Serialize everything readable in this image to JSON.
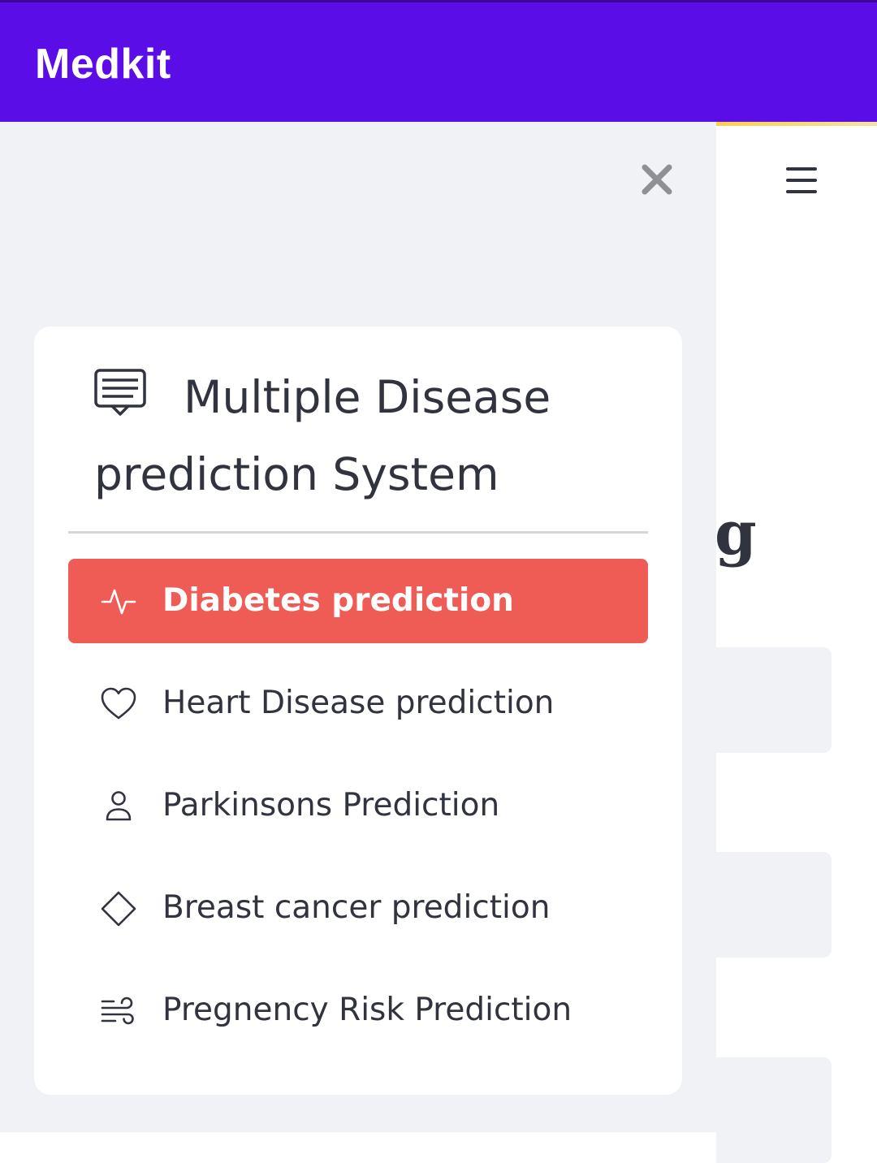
{
  "app": {
    "title": "Medkit",
    "accent_color": "#5b0de8"
  },
  "main_content": {
    "heading_fragment": "g"
  },
  "sidebar": {
    "close_icon": "close-icon",
    "menu": {
      "title": "Multiple Disease prediction System",
      "title_icon": "list-message-icon",
      "selected_index": 0,
      "selected_color": "#ee5c55",
      "items": [
        {
          "label": "Diabetes prediction",
          "icon": "activity-icon"
        },
        {
          "label": "Heart Disease prediction",
          "icon": "heart-icon"
        },
        {
          "label": "Parkinsons Prediction",
          "icon": "person-icon"
        },
        {
          "label": "Breast cancer prediction",
          "icon": "diamond-icon"
        },
        {
          "label": "Pregnency Risk Prediction",
          "icon": "wind-icon"
        }
      ]
    }
  }
}
